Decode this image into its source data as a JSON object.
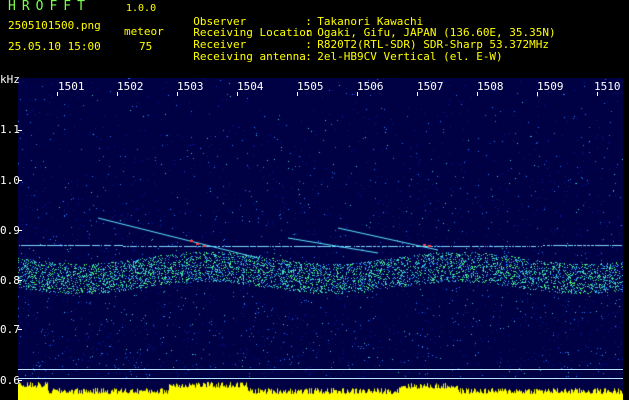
{
  "header": {
    "app_title": "HROFFT",
    "app_version": "1.0.0",
    "file_name": "2505101500.png",
    "meteor_label": "meteor",
    "datetime": "25.05.10 15:00",
    "meteor_count": "75"
  },
  "info": [
    {
      "label": "Observer",
      "sep": ":",
      "value": "Takanori Kawachi"
    },
    {
      "label": "Receiving Location",
      "sep": ":",
      "value": "Ogaki, Gifu, JAPAN (136.60E, 35.35N)"
    },
    {
      "label": "Receiver",
      "sep": ":",
      "value": "R820T2(RTL-SDR) SDR-Sharp 53.372MHz"
    },
    {
      "label": "Receiving antenna",
      "sep": ":",
      "value": "2el-HB9CV Vertical (el. E-W)"
    }
  ],
  "spectrogram": {
    "y_unit": "kHz",
    "y_labels": [
      "1.1",
      "1.0",
      "0.9",
      "0.8",
      "0.7",
      "0.6"
    ],
    "x_labels": [
      "1501",
      "1502",
      "1503",
      "1504",
      "1505",
      "1506",
      "1507",
      "1508",
      "1509",
      "1510"
    ],
    "colors": {
      "background": "#000044",
      "noise_low": "#0a1ea0",
      "noise_high": "#2a7cff",
      "signal": "#3cd7c8",
      "hot": "#ff4040",
      "level_bar": "#ffff00"
    }
  }
}
